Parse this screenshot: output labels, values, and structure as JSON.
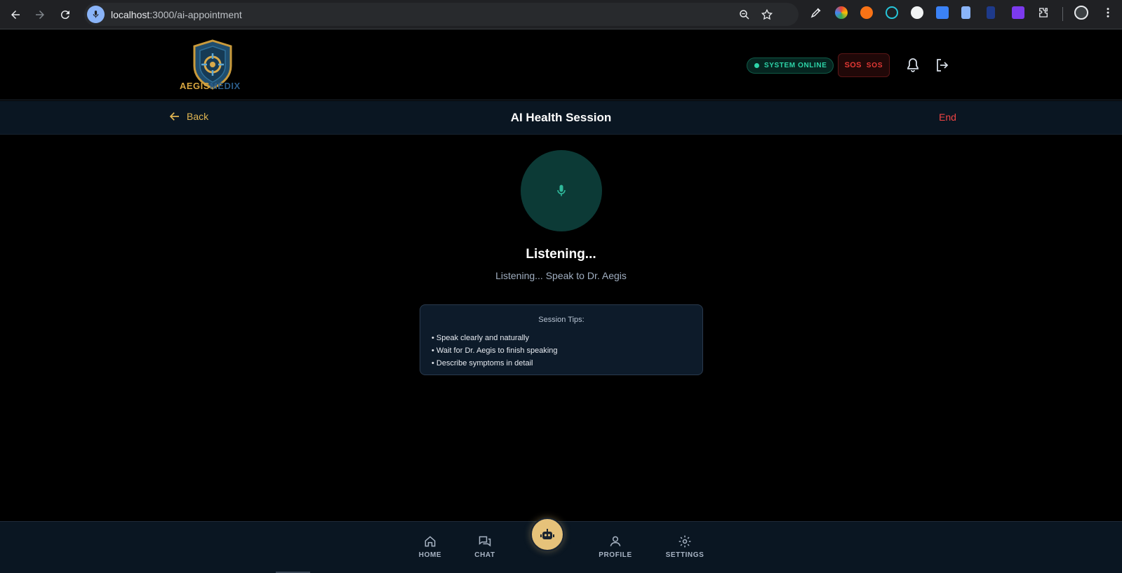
{
  "browser": {
    "url_host": "localhost",
    "url_path": ":3000/ai-appointment"
  },
  "header": {
    "logo_text_a": "AEGIS",
    "logo_text_b": "MEDIX",
    "status_label": "SYSTEM ONLINE",
    "sos_icon_text": "SOS",
    "sos_label": "SOS"
  },
  "session_bar": {
    "back_label": "Back",
    "title": "AI Health Session",
    "end_label": "End"
  },
  "main": {
    "listen_title": "Listening...",
    "listen_subtitle": "Listening... Speak to Dr. Aegis",
    "tips": {
      "title": "Session Tips:",
      "items": [
        "• Speak clearly and naturally",
        "• Wait for Dr. Aegis to finish speaking",
        "• Describe symptoms in detail"
      ]
    }
  },
  "bottom_nav": {
    "items": [
      {
        "label": "HOME",
        "icon": "home-icon"
      },
      {
        "label": "CHAT",
        "icon": "chat-icon"
      },
      {
        "label": "PROFILE",
        "icon": "user-icon"
      },
      {
        "label": "SETTINGS",
        "icon": "gear-icon"
      }
    ],
    "fab_icon": "robot-icon"
  },
  "colors": {
    "accent_gold": "#e0b552",
    "online_green": "#2dd4a8",
    "danger_red": "#ef4444",
    "mic_bg": "#0c3a36"
  }
}
